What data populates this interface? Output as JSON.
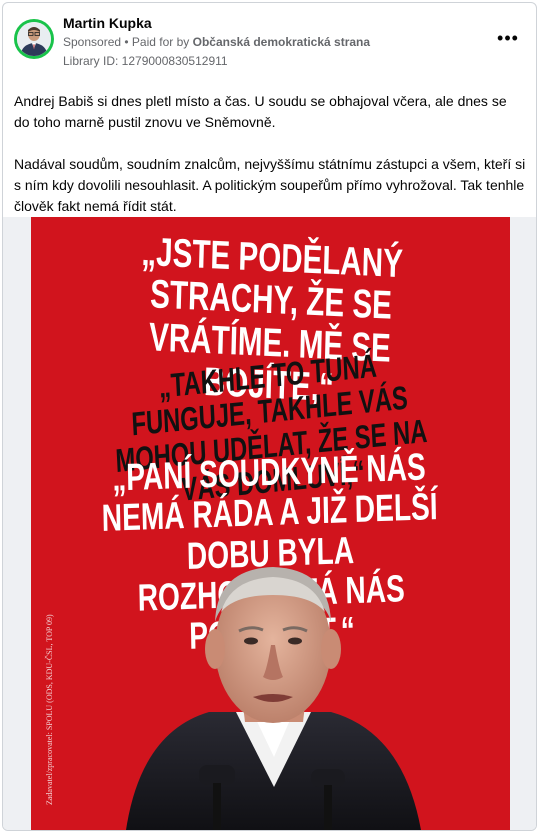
{
  "post": {
    "author": "Martin Kupka",
    "sponsored": "Sponsored",
    "separator": " • ",
    "paid_for_prefix": "Paid for by ",
    "payer": "Občanská demokratická strana",
    "library_id": "Library ID: 1279000830512911",
    "more_label": "•••",
    "paragraph_1": "Andrej Babiš si dnes pletl místo a čas. U soudu se obhajoval včera, ale dnes se do toho marně pustil znovu ve Sněmovně.",
    "paragraph_2": "Nadával soudům, soudním znalcům, nejvyššímu státnímu zástupci a všem, kteří si s ním kdy dovolili nesouhlasit. A politickým soupeřům přímo vyhrožoval. Tak tenhle člověk fakt nemá řídit stát."
  },
  "poster": {
    "quote_1": "„Jste podělaný strachy, že se vrátíme. Mě se bojíte,“",
    "quote_2": "„Takhle to tuná funguje, takhle vás mohou udělat, že se na vás domluví,“",
    "quote_3": "„Paní soudkyně nás nemá ráda a již delší dobu byla rozhodnutá nás poškodit,“",
    "imprint": "Zadavatel/zpracovatel: SPOLU (ODS, KDU-ČSL, TOP 09)",
    "background_color": "#d1141d"
  },
  "colors": {
    "avatar_ring": "#19c34a",
    "meta_text": "#65676b"
  }
}
